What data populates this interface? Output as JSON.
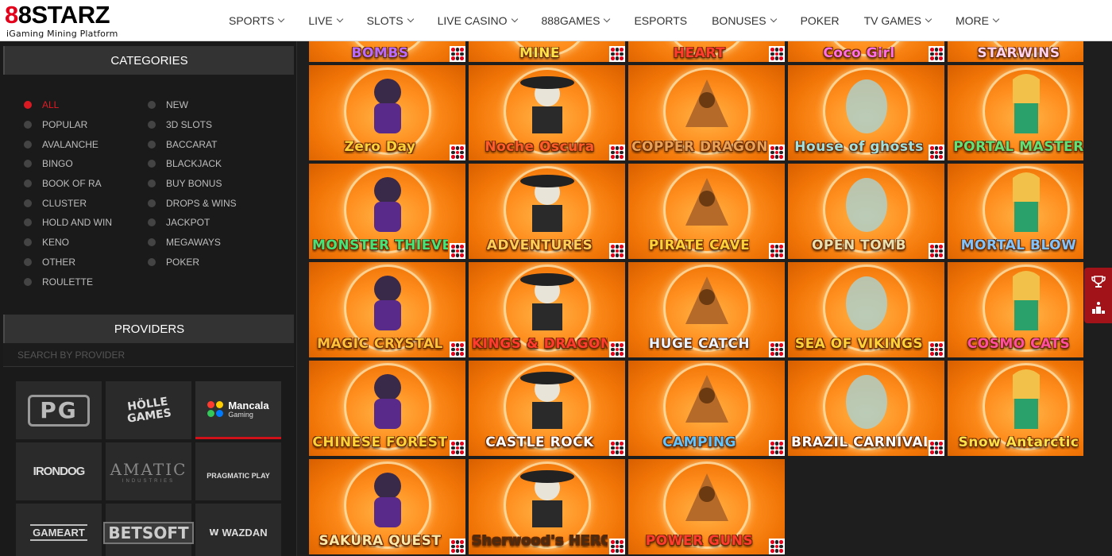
{
  "header": {
    "logo_prefix": "8",
    "logo_mid": "8",
    "logo_text": "STARZ",
    "logo_sub": "iGaming Mining Platform",
    "nav": [
      {
        "label": "SPORTS",
        "chevron": true
      },
      {
        "label": "LIVE",
        "chevron": true
      },
      {
        "label": "SLOTS",
        "chevron": true
      },
      {
        "label": "LIVE CASINO",
        "chevron": true
      },
      {
        "label": "888GAMES",
        "chevron": true
      },
      {
        "label": "ESPORTS",
        "chevron": false
      },
      {
        "label": "BONUSES",
        "chevron": true
      },
      {
        "label": "POKER",
        "chevron": false
      },
      {
        "label": "TV GAMES",
        "chevron": true
      },
      {
        "label": "MORE",
        "chevron": true
      }
    ]
  },
  "sidebar": {
    "categories_title": "CATEGORIES",
    "categories_left": [
      "ALL",
      "POPULAR",
      "AVALANCHE",
      "BINGO",
      "BOOK OF RA",
      "CLUSTER",
      "HOLD AND WIN",
      "KENO",
      "OTHER",
      "ROULETTE"
    ],
    "categories_right": [
      "NEW",
      "3D SLOTS",
      "BACCARAT",
      "BLACKJACK",
      "BUY BONUS",
      "DROPS & WINS",
      "JACKPOT",
      "MEGAWAYS",
      "POKER"
    ],
    "active_category": "ALL",
    "providers_title": "PROVIDERS",
    "provider_search_placeholder": "SEARCH BY PROVIDER",
    "providers": [
      {
        "name": "PG",
        "style": "pg"
      },
      {
        "name": "HÖLLE GAMES",
        "style": "holle"
      },
      {
        "name": "Mancala",
        "sub": "Gaming",
        "style": "mancala",
        "active": true
      },
      {
        "name": "IRONDOG",
        "style": "irondog"
      },
      {
        "name": "AMATIC",
        "sub": "INDUSTRIES",
        "style": "amatic"
      },
      {
        "name": "PRAGMATIC PLAY",
        "style": "pragmatic"
      },
      {
        "name": "GAMEART",
        "style": "gameart"
      },
      {
        "name": "BETSOFT",
        "style": "betsoft"
      },
      {
        "name": "WAZDAN",
        "style": "wazdan"
      }
    ]
  },
  "games": [
    {
      "title": "BOMBS",
      "row": 0,
      "col": 0,
      "color": "#b56cff"
    },
    {
      "title": "MINE",
      "row": 0,
      "col": 1,
      "color": "#ffe24a"
    },
    {
      "title": "HEART",
      "row": 0,
      "col": 2,
      "color": "#ff3b2f"
    },
    {
      "title": "Coco Girl",
      "row": 0,
      "col": 3,
      "color": "#ff6ee8"
    },
    {
      "title": "STARWINS",
      "row": 0,
      "col": 4,
      "color": "#ffd3f0"
    },
    {
      "title": "Zero Day",
      "row": 1,
      "col": 0,
      "color": "#ffd23a"
    },
    {
      "title": "Noche Oscura",
      "row": 1,
      "col": 1,
      "color": "#ff5a2a"
    },
    {
      "title": "COPPER DRAGON",
      "row": 1,
      "col": 2,
      "color": "#e8a157"
    },
    {
      "title": "House of ghosts",
      "row": 1,
      "col": 3,
      "color": "#9fe0e0"
    },
    {
      "title": "PORTAL MASTER",
      "row": 1,
      "col": 4,
      "color": "#5fe27a"
    },
    {
      "title": "MONSTER THIEVES",
      "row": 2,
      "col": 0,
      "color": "#45e37a"
    },
    {
      "title": "ADVENTURES",
      "row": 2,
      "col": 1,
      "color": "#ffcf5a"
    },
    {
      "title": "PIRATE CAVE",
      "row": 2,
      "col": 2,
      "color": "#ffd23a"
    },
    {
      "title": "OPEN TOMB",
      "row": 2,
      "col": 3,
      "color": "#e8e0b0"
    },
    {
      "title": "MORTAL BLOW",
      "row": 2,
      "col": 4,
      "color": "#7fc4ff"
    },
    {
      "title": "MAGIC CRYSTAL",
      "row": 3,
      "col": 0,
      "color": "#ffc23a"
    },
    {
      "title": "KINGS & DRAGONS",
      "row": 3,
      "col": 1,
      "color": "#ff3b2f"
    },
    {
      "title": "HUGE CATCH",
      "row": 3,
      "col": 2,
      "color": "#e8f4ff"
    },
    {
      "title": "SEA OF VIKINGS",
      "row": 3,
      "col": 3,
      "color": "#ffd23a"
    },
    {
      "title": "COSMO CATS",
      "row": 3,
      "col": 4,
      "color": "#ff4fa0"
    },
    {
      "title": "CHINESE FOREST",
      "row": 4,
      "col": 0,
      "color": "#ffd23a"
    },
    {
      "title": "CASTLE ROCK",
      "row": 4,
      "col": 1,
      "color": "#ffffff"
    },
    {
      "title": "CAMPING",
      "row": 4,
      "col": 2,
      "color": "#5fc4ff"
    },
    {
      "title": "BRAZIL CARNIVAL",
      "row": 4,
      "col": 3,
      "color": "#ffffff"
    },
    {
      "title": "Snow Antarctic",
      "row": 4,
      "col": 4,
      "color": "#ffe24a"
    },
    {
      "title": "SAKURA QUEST",
      "row": 5,
      "col": 0,
      "color": "#ffe9a8"
    },
    {
      "title": "Sherwood's HERO",
      "row": 5,
      "col": 1,
      "color": "#4a2a10"
    },
    {
      "title": "POWER GUNS",
      "row": 5,
      "col": 2,
      "color": "#ff3b2f"
    }
  ],
  "side_float": {
    "icons": [
      "trophy-icon",
      "podium-icon"
    ]
  }
}
